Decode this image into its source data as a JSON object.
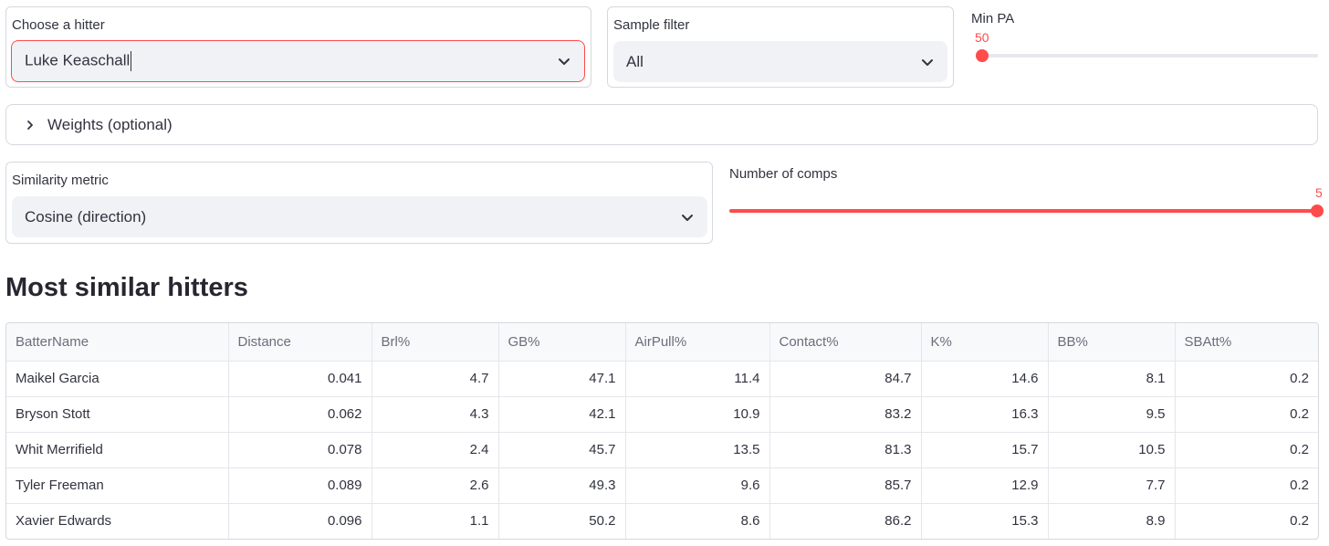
{
  "hitter_select": {
    "label": "Choose a hitter",
    "value": "Luke Keaschall"
  },
  "sample_filter": {
    "label": "Sample filter",
    "value": "All"
  },
  "min_pa": {
    "label": "Min PA",
    "value": "50",
    "fraction": 0.0
  },
  "weights": {
    "label": "Weights (optional)"
  },
  "similarity_metric": {
    "label": "Similarity metric",
    "value": "Cosine (direction)"
  },
  "num_comps": {
    "label": "Number of comps",
    "value": "5",
    "fraction": 1.0
  },
  "results": {
    "title": "Most similar hitters",
    "columns": [
      "BatterName",
      "Distance",
      "Brl%",
      "GB%",
      "AirPull%",
      "Contact%",
      "K%",
      "BB%",
      "SBAtt%"
    ],
    "rows": [
      [
        "Maikel Garcia",
        "0.041",
        "4.7",
        "47.1",
        "11.4",
        "84.7",
        "14.6",
        "8.1",
        "0.2"
      ],
      [
        "Bryson Stott",
        "0.062",
        "4.3",
        "42.1",
        "10.9",
        "83.2",
        "16.3",
        "9.5",
        "0.2"
      ],
      [
        "Whit Merrifield",
        "0.078",
        "2.4",
        "45.7",
        "13.5",
        "81.3",
        "15.7",
        "10.5",
        "0.2"
      ],
      [
        "Tyler Freeman",
        "0.089",
        "2.6",
        "49.3",
        "9.6",
        "85.7",
        "12.9",
        "7.7",
        "0.2"
      ],
      [
        "Xavier Edwards",
        "0.096",
        "1.1",
        "50.2",
        "8.6",
        "86.2",
        "15.3",
        "8.9",
        "0.2"
      ]
    ]
  },
  "colors": {
    "accent": "#ff4b4b",
    "input_bg": "#f0f2f6",
    "text": "#31333f"
  },
  "icons": {
    "select_chevron": "chevron-down-icon",
    "expander": "chevron-right-icon"
  }
}
